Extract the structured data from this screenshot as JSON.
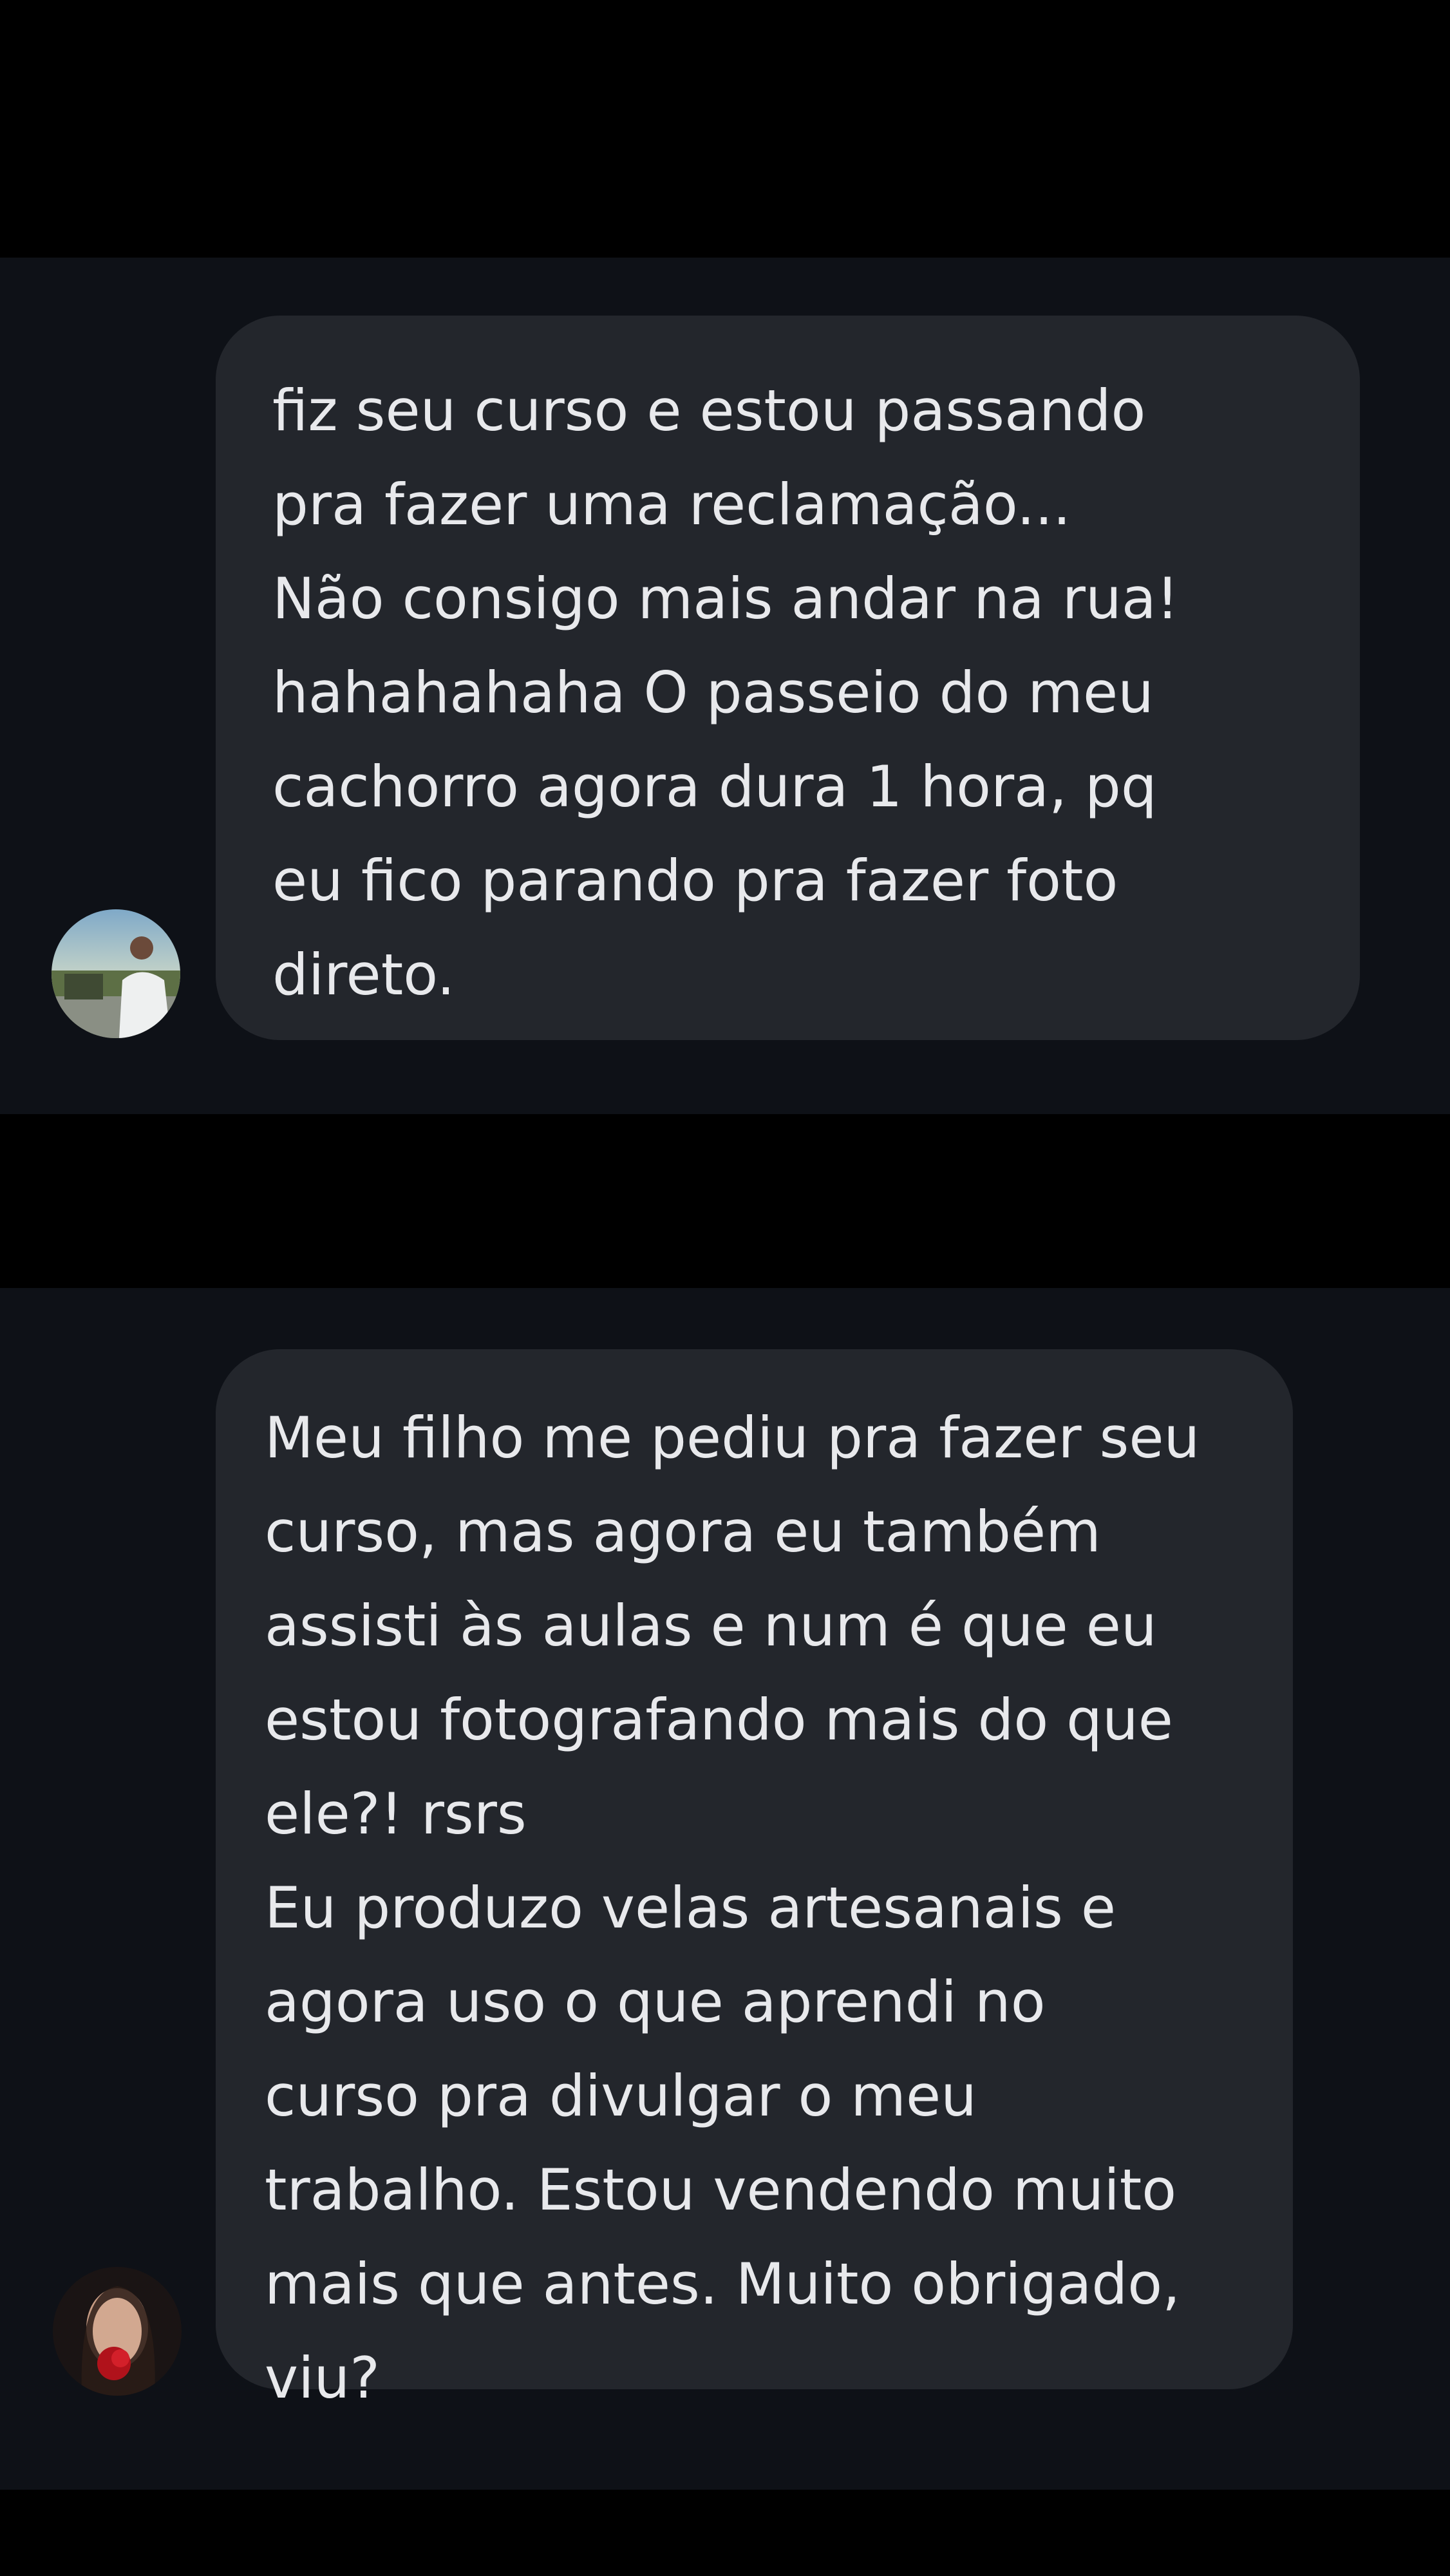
{
  "conversation": {
    "messages": [
      {
        "text": "fiz seu curso e estou passando\npra fazer uma reclamação...\nNão consigo mais andar na rua!\nhahahahaha O passeio do meu\ncachorro agora dura 1 hora, pq\neu fico parando pra fazer foto\ndireto."
      },
      {
        "text": "Meu filho me pediu pra fazer seu\ncurso, mas agora eu também\nassisti às aulas e num é que eu\nestou fotografando mais do que\nele?! rsrs\nEu produzo velas artesanais e\nagora uso o que aprendi no\ncurso pra divulgar o meu\ntrabalho. Estou vendendo muito\nmais que antes. Muito obrigado,\nviu?"
      }
    ]
  },
  "colors": {
    "page_background": "#000000",
    "panel_background": "#0e1117",
    "bubble_background": "#23262c",
    "text": "#e8e9ec"
  }
}
